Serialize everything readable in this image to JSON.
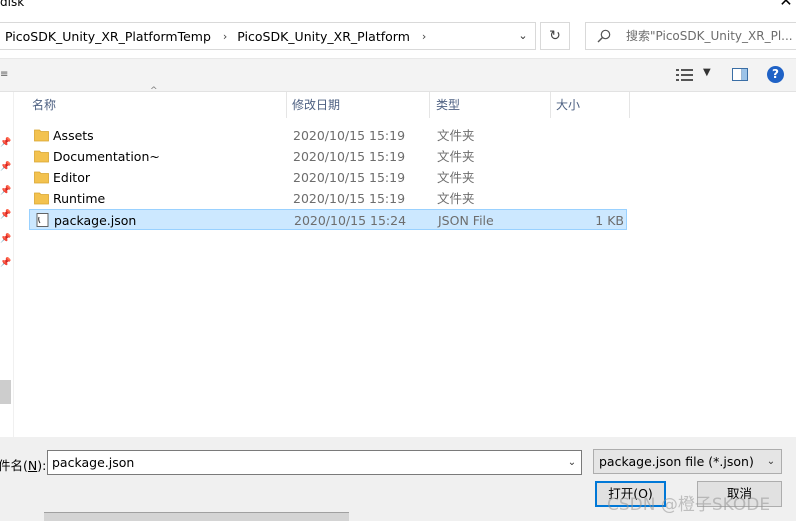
{
  "window": {
    "title": "disk"
  },
  "address": {
    "breadcrumbs": [
      "PicoSDK_Unity_XR_PlatformTemp",
      "PicoSDK_Unity_XR_Platform"
    ]
  },
  "search": {
    "placeholder": "搜索\"PicoSDK_Unity_XR_Pl..."
  },
  "columns": {
    "name": "名称",
    "date": "修改日期",
    "type": "类型",
    "size": "大小"
  },
  "files": [
    {
      "name": "Assets",
      "date": "2020/10/15 15:19",
      "type": "文件夹",
      "size": "",
      "icon": "folder-icon",
      "selected": false
    },
    {
      "name": "Documentation~",
      "date": "2020/10/15 15:19",
      "type": "文件夹",
      "size": "",
      "icon": "folder-icon",
      "selected": false
    },
    {
      "name": "Editor",
      "date": "2020/10/15 15:19",
      "type": "文件夹",
      "size": "",
      "icon": "folder-icon",
      "selected": false
    },
    {
      "name": "Runtime",
      "date": "2020/10/15 15:19",
      "type": "文件夹",
      "size": "",
      "icon": "folder-icon",
      "selected": false
    },
    {
      "name": "package.json",
      "date": "2020/10/15 15:24",
      "type": "JSON File",
      "size": "1 KB",
      "icon": "json-file-icon",
      "selected": true
    }
  ],
  "footer": {
    "filename_label": "件名",
    "filename_hotkey": "N",
    "filename_value": "package.json",
    "filter_value": "package.json file (*.json)",
    "open_label": "打开(O)",
    "cancel_label": "取消"
  },
  "watermark": "CSDN @橙子SKODE",
  "colors": {
    "selection_bg": "#cce8ff",
    "selection_border": "#99d1ff",
    "folder": "#f3c24f",
    "header_text": "#4d6082",
    "accent": "#0078d7"
  }
}
